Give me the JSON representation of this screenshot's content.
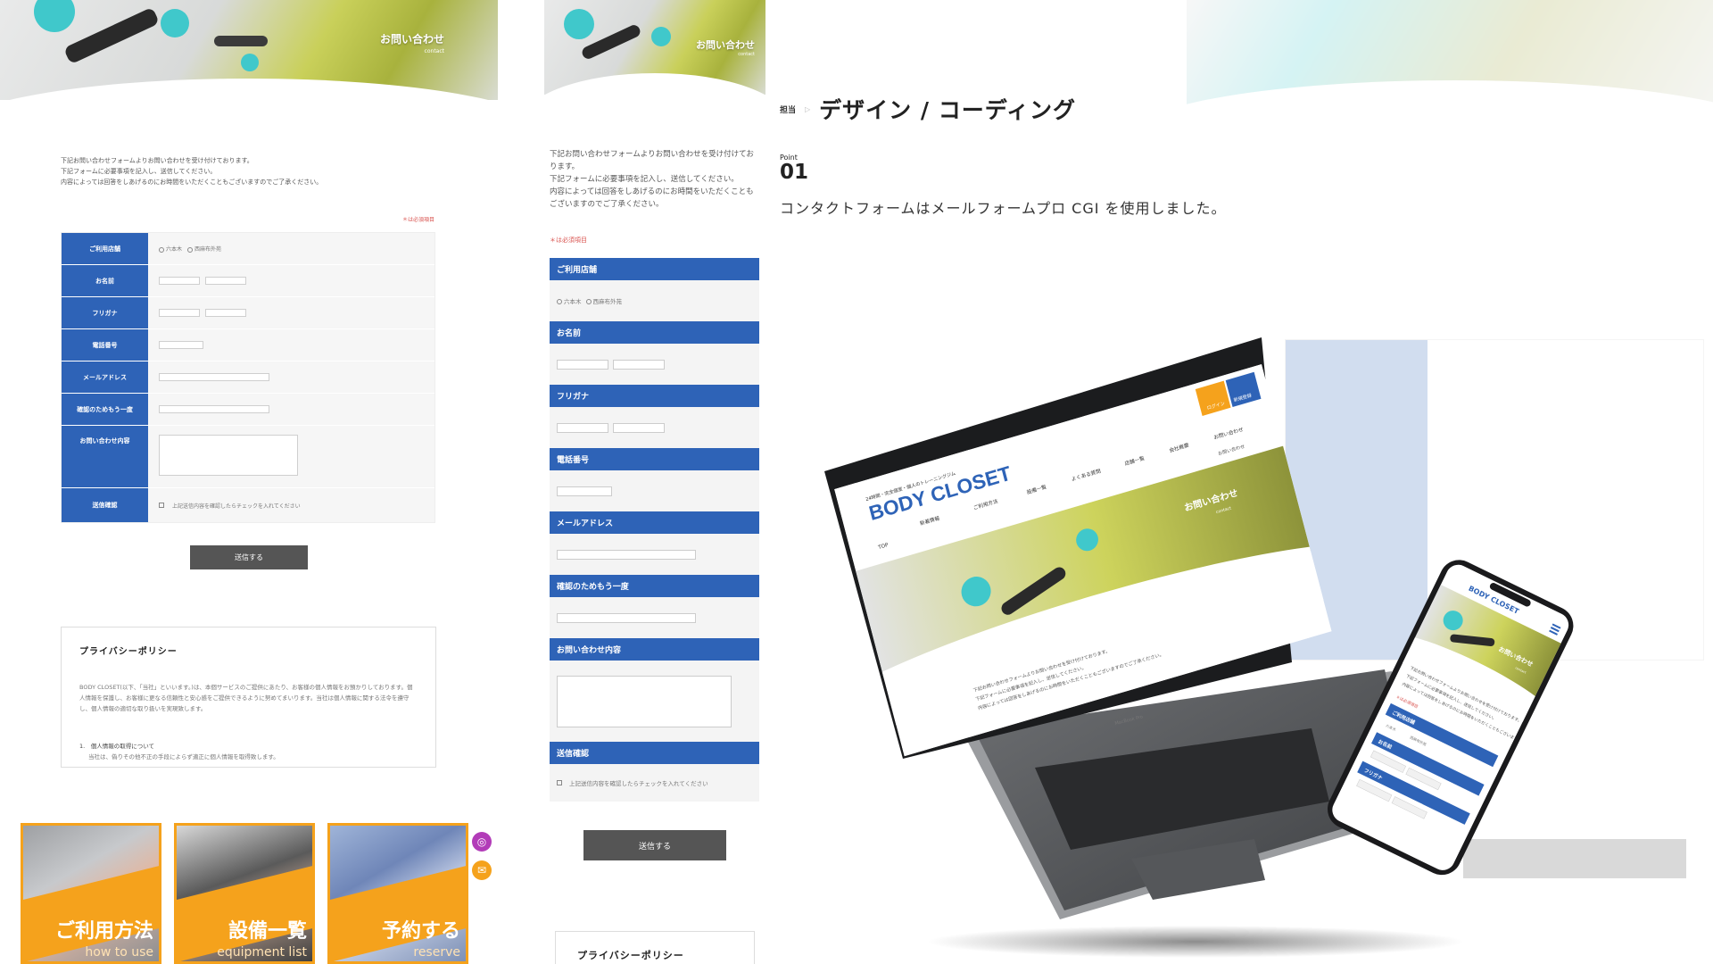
{
  "desktop": {
    "hero_title": "お問い合わせ",
    "hero_sub": "contact",
    "intro": [
      "下記お問い合わせフォームよりお問い合わせを受け付けております。",
      "下記フォームに必要事項を記入し、送信してください。",
      "内容によっては回答をしあげるのにお時間をいただくこともございますのでご了承ください。"
    ],
    "required_note": "＊は必須項目",
    "form": {
      "store_label": "ご利用店舗",
      "store_options": [
        "六本木",
        "西麻布外苑"
      ],
      "name_label": "お名前",
      "kana_label": "フリガナ",
      "phone_label": "電話番号",
      "email_label": "メールアドレス",
      "email_confirm_label": "確認のためもう一度",
      "inquiry_label": "お問い合わせ内容",
      "confirm_label": "送信確認",
      "confirm_text": "上記送信内容を確認したらチェックを入れてください"
    },
    "submit": "送信する",
    "privacy": {
      "title": "プライバシーポリシー",
      "body": "BODY CLOSET(以下、「当社」といいます。)は、本個サービスのご提供にあたり、お客様の個人情報をお預かりしております。個人情報を保護し、お客様に更なる信頼性と安心感をご提供できるように努めてまいります。当社は個人情報に関する法令を遵守し、個人情報の適切な取り扱いを実現致します。",
      "section_title": "1.　個人情報の取得について",
      "section_body": "当社は、偽りその他不正の手段によらず適正に個人情報を取得致します。"
    },
    "cards": [
      {
        "title": "ご利用方法",
        "sub": "how to use"
      },
      {
        "title": "設備一覧",
        "sub": "equipment list"
      },
      {
        "title": "予約する",
        "sub": "reserve"
      }
    ],
    "side_icons": [
      "instagram-icon",
      "mail-icon"
    ]
  },
  "mobile": {
    "hero_title": "お問い合わせ",
    "hero_sub": "contact",
    "intro": [
      "下記お問い合わせフォームよりお問い合わせを受け付けております。",
      "下記フォームに必要事項を記入し、送信してください。",
      "内容によっては回答をしあげるのにお時間をいただくこともございますのでご了承ください。"
    ],
    "required_note": "＊は必須項目",
    "labels": [
      "ご利用店舗",
      "お名前",
      "フリガナ",
      "電話番号",
      "メールアドレス",
      "確認のためもう一度",
      "お問い合わせ内容",
      "送信確認"
    ],
    "store_options": [
      "六本木",
      "西麻布外苑"
    ],
    "confirm_text": "上記送信内容を確認したらチェックを入れてください",
    "submit": "送信する",
    "privacy_title": "プライバシーポリシー"
  },
  "description": {
    "role_tag": "担当",
    "role_title": "デザイン / コーディング",
    "point_label": "Point",
    "point_number": "01",
    "point_text": "コンタクトフォームはメールフォームプロ CGI を使用しました。"
  },
  "laptop_screen": {
    "tagline": "24時間・完全個室・個人のトレーニングジム",
    "brand": "BODY CLOSET",
    "nav": [
      "TOP",
      "新着情報",
      "ご利用方法",
      "設備一覧",
      "よくある質問",
      "店舗一覧",
      "会社概要",
      "お問い合わせ"
    ],
    "login": "ログイン",
    "register": "新規登録",
    "breadcrumb": "お問い合わせ",
    "hero_title": "お問い合わせ",
    "hero_sub": "contact",
    "intro": [
      "下記お問い合わせフォームよりお問い合わせを受け付けております。",
      "下記フォームに必要事項を記入し、送信してください。",
      "内容によっては回答をしあげるのにお時間をいただくこともございますのでご了承ください。"
    ],
    "keyboard_brand": "MacBook Pro"
  },
  "phone_screen": {
    "brand": "BODY CLOSET",
    "hero_title": "お問い合わせ",
    "hero_sub": "contact",
    "intro": [
      "下記お問い合わせフォームよりお問い合わせを受け付けております。",
      "下記フォームに必要事項を記入し、送信してください。",
      "内容によっては回答をしあげるのにお時間をいただくこともございますのでご了承ください。"
    ],
    "required_note": "＊は必須項目",
    "labels": [
      "ご利用店舗",
      "お名前",
      "フリガナ"
    ],
    "store_options": [
      "六本木",
      "西麻布外苑"
    ]
  },
  "colors": {
    "form_blue": "#2e63b7",
    "accent_orange": "#f5a21c",
    "olive": "#9ea43a",
    "button_gray": "#555555",
    "turquoise": "#3fc6c9"
  }
}
